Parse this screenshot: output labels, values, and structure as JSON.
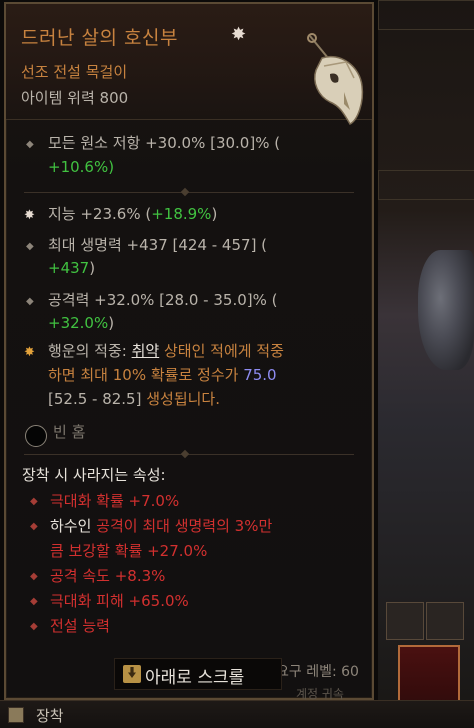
{
  "item": {
    "name": "드러난 살의 호신부",
    "name_star": "✸",
    "type": "선조 전설 목걸이",
    "power": "아이템 위력 800"
  },
  "implicit": {
    "text1": "모든 원소 저항 +30.0% [30.0]% (",
    "text2": "+10.6%)"
  },
  "affixes": [
    {
      "label": "지능 +23.6% (",
      "green": "+18.9%",
      "tail": ")"
    },
    {
      "line1": "최대 생명력 +437 [424 - 457] (",
      "line2_green": "+437",
      "line2_tail": ")"
    },
    {
      "line1": "공격력 +32.0% [28.0 - 35.0]% (",
      "line2_green": "+32.0%",
      "line2_tail": ")"
    }
  ],
  "legendary": {
    "lead": "행운의 적중: ",
    "keyword": "취약",
    "rest1": " 상태인 적에게 적중",
    "line2": "하면 최대 10% 확률로 정수가 ",
    "value": "75.0",
    "line3_range": "[52.5 - 82.5]",
    "line3_rest": " 생성됩니다."
  },
  "socket": {
    "label": "빈 홈"
  },
  "lost_section": {
    "heading": "장착 시 사라지는 속성:",
    "items": [
      "극대화 확률 +7.0%",
      "공격 속도 +8.3%",
      "극대화 피해 +65.0%",
      "전설 능력"
    ],
    "hasuin_white": "하수인 ",
    "hasuin_red": "공격이 최대 생명력의 3%만",
    "hasuin_line2": "큼 보강할 확률 +27.0%"
  },
  "footer": {
    "scroll_label": "아래로 스크롤",
    "req_level": "요구 레벨: 60",
    "req_sub": "계정 귀속"
  },
  "bottom": {
    "label": "장착"
  },
  "colors": {
    "legendary_orange": "#c7823f",
    "green": "#41c241",
    "red": "#d2302f",
    "blue": "#8e8cf2"
  }
}
